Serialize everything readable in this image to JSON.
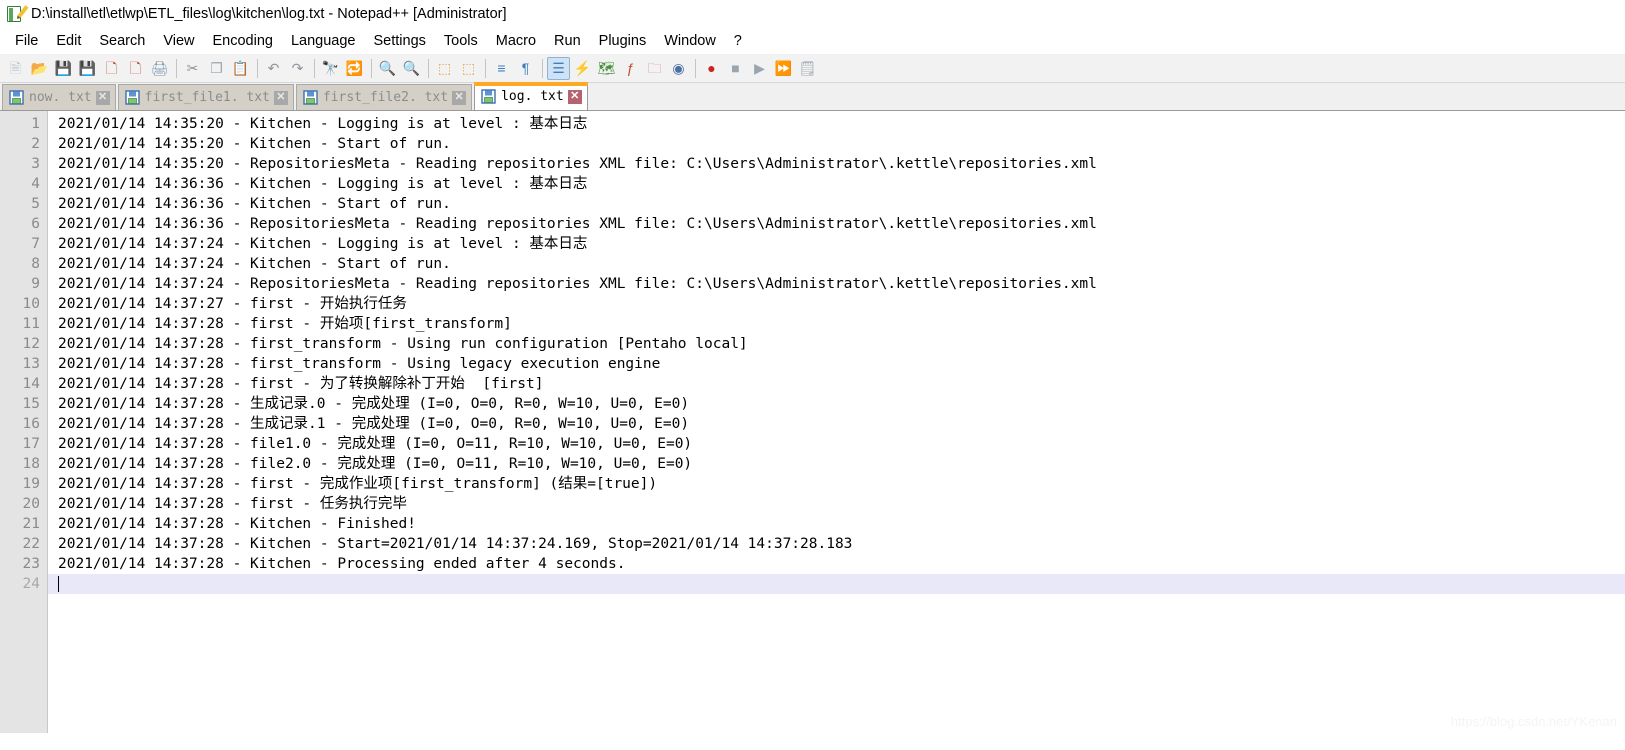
{
  "window": {
    "title": "D:\\install\\etl\\etlwp\\ETL_files\\log\\kitchen\\log.txt - Notepad++ [Administrator]",
    "app_icon": "notepad-plus-plus-icon"
  },
  "menu": {
    "items": [
      {
        "label": "File"
      },
      {
        "label": "Edit"
      },
      {
        "label": "Search"
      },
      {
        "label": "View"
      },
      {
        "label": "Encoding"
      },
      {
        "label": "Language"
      },
      {
        "label": "Settings"
      },
      {
        "label": "Tools"
      },
      {
        "label": "Macro"
      },
      {
        "label": "Run"
      },
      {
        "label": "Plugins"
      },
      {
        "label": "Window"
      },
      {
        "label": "?"
      }
    ]
  },
  "toolbar": {
    "buttons": [
      {
        "name": "new-file-icon",
        "glyph": "🗎",
        "color": "#b9c4cc",
        "active": false
      },
      {
        "name": "open-file-icon",
        "glyph": "📂",
        "color": "#e8a83c",
        "active": false
      },
      {
        "name": "save-icon",
        "glyph": "💾",
        "color": "#9aa5ad",
        "active": false
      },
      {
        "name": "save-all-icon",
        "glyph": "💾",
        "color": "#9aa5ad",
        "active": false
      },
      {
        "name": "close-file-icon",
        "glyph": "🗋",
        "color": "#c24a2e",
        "active": false
      },
      {
        "name": "close-all-files-icon",
        "glyph": "🗋",
        "color": "#c24a2e",
        "active": false
      },
      {
        "name": "print-icon",
        "glyph": "🖨",
        "color": "#7f97ad",
        "active": false
      },
      {
        "sep": true
      },
      {
        "name": "cut-icon",
        "glyph": "✂",
        "color": "#8d949b",
        "active": false
      },
      {
        "name": "copy-icon",
        "glyph": "❐",
        "color": "#9aa5ad",
        "active": false
      },
      {
        "name": "paste-icon",
        "glyph": "📋",
        "color": "#9aa5ad",
        "active": false
      },
      {
        "sep": true
      },
      {
        "name": "undo-icon",
        "glyph": "↶",
        "color": "#8d949b",
        "active": false
      },
      {
        "name": "redo-icon",
        "glyph": "↷",
        "color": "#8d949b",
        "active": false
      },
      {
        "sep": true
      },
      {
        "name": "find-icon",
        "glyph": "🔭",
        "color": "#4a545c",
        "active": false
      },
      {
        "name": "replace-icon",
        "glyph": "🔁",
        "color": "#3d7ec4",
        "active": false
      },
      {
        "sep": true
      },
      {
        "name": "zoom-in-icon",
        "glyph": "🔍",
        "color": "#4a8f3e",
        "active": false
      },
      {
        "name": "zoom-out-icon",
        "glyph": "🔍",
        "color": "#c24a2e",
        "active": false
      },
      {
        "sep": true
      },
      {
        "name": "sync-vertical-scroll-icon",
        "glyph": "⬚",
        "color": "#d8a73c",
        "active": false
      },
      {
        "name": "sync-horizontal-scroll-icon",
        "glyph": "⬚",
        "color": "#d8a73c",
        "active": false
      },
      {
        "sep": true
      },
      {
        "name": "word-wrap-icon",
        "glyph": "≡",
        "color": "#3d7ec4",
        "active": false
      },
      {
        "name": "show-all-characters-icon",
        "glyph": "¶",
        "color": "#3d7ec4",
        "active": false
      },
      {
        "sep": true
      },
      {
        "name": "indent-guideline-icon",
        "glyph": "☰",
        "color": "#3d7ec4",
        "active": true
      },
      {
        "name": "user-defined-language-icon",
        "glyph": "⚡",
        "color": "#e8c03c",
        "active": false
      },
      {
        "name": "document-map-icon",
        "glyph": "🗺",
        "color": "#4a8f3e",
        "active": false
      },
      {
        "name": "function-list-icon",
        "glyph": "ƒ",
        "color": "#c24a2e",
        "active": false
      },
      {
        "name": "folder-as-workspace-icon",
        "glyph": "🗀",
        "color": "#d98a8a",
        "active": false
      },
      {
        "name": "monitoring-icon",
        "glyph": "◉",
        "color": "#4a6fa5",
        "active": false
      },
      {
        "sep": true
      },
      {
        "name": "macro-record-icon",
        "glyph": "●",
        "color": "#cc2222",
        "active": false
      },
      {
        "name": "macro-stop-icon",
        "glyph": "■",
        "color": "#9aa5ad",
        "active": false
      },
      {
        "name": "macro-play-icon",
        "glyph": "▶",
        "color": "#9aa5ad",
        "active": false
      },
      {
        "name": "macro-run-multiple-icon",
        "glyph": "⏩",
        "color": "#3d7ec4",
        "active": false
      },
      {
        "name": "save-macro-icon",
        "glyph": "🗒",
        "color": "#9aa5ad",
        "active": false
      }
    ]
  },
  "tabs": [
    {
      "label": "now. txt",
      "active": false,
      "icon": "saved-file-icon"
    },
    {
      "label": "first_file1. txt",
      "active": false,
      "icon": "saved-file-icon"
    },
    {
      "label": "first_file2. txt",
      "active": false,
      "icon": "saved-file-icon"
    },
    {
      "label": "log. txt",
      "active": true,
      "icon": "saved-file-icon"
    }
  ],
  "editor": {
    "current_line": 24,
    "lines": [
      {
        "n": 1,
        "text": "2021/01/14 14:35:20 - Kitchen - Logging is at level : 基本日志"
      },
      {
        "n": 2,
        "text": "2021/01/14 14:35:20 - Kitchen - Start of run."
      },
      {
        "n": 3,
        "text": "2021/01/14 14:35:20 - RepositoriesMeta - Reading repositories XML file: C:\\Users\\Administrator\\.kettle\\repositories.xml"
      },
      {
        "n": 4,
        "text": "2021/01/14 14:36:36 - Kitchen - Logging is at level : 基本日志"
      },
      {
        "n": 5,
        "text": "2021/01/14 14:36:36 - Kitchen - Start of run."
      },
      {
        "n": 6,
        "text": "2021/01/14 14:36:36 - RepositoriesMeta - Reading repositories XML file: C:\\Users\\Administrator\\.kettle\\repositories.xml"
      },
      {
        "n": 7,
        "text": "2021/01/14 14:37:24 - Kitchen - Logging is at level : 基本日志"
      },
      {
        "n": 8,
        "text": "2021/01/14 14:37:24 - Kitchen - Start of run."
      },
      {
        "n": 9,
        "text": "2021/01/14 14:37:24 - RepositoriesMeta - Reading repositories XML file: C:\\Users\\Administrator\\.kettle\\repositories.xml"
      },
      {
        "n": 10,
        "text": "2021/01/14 14:37:27 - first - 开始执行任务"
      },
      {
        "n": 11,
        "text": "2021/01/14 14:37:28 - first - 开始项[first_transform]"
      },
      {
        "n": 12,
        "text": "2021/01/14 14:37:28 - first_transform - Using run configuration [Pentaho local]"
      },
      {
        "n": 13,
        "text": "2021/01/14 14:37:28 - first_transform - Using legacy execution engine"
      },
      {
        "n": 14,
        "text": "2021/01/14 14:37:28 - first - 为了转换解除补丁开始  [first]"
      },
      {
        "n": 15,
        "text": "2021/01/14 14:37:28 - 生成记录.0 - 完成处理 (I=0, O=0, R=0, W=10, U=0, E=0)"
      },
      {
        "n": 16,
        "text": "2021/01/14 14:37:28 - 生成记录.1 - 完成处理 (I=0, O=0, R=0, W=10, U=0, E=0)"
      },
      {
        "n": 17,
        "text": "2021/01/14 14:37:28 - file1.0 - 完成处理 (I=0, O=11, R=10, W=10, U=0, E=0)"
      },
      {
        "n": 18,
        "text": "2021/01/14 14:37:28 - file2.0 - 完成处理 (I=0, O=11, R=10, W=10, U=0, E=0)"
      },
      {
        "n": 19,
        "text": "2021/01/14 14:37:28 - first - 完成作业项[first_transform] (结果=[true])"
      },
      {
        "n": 20,
        "text": "2021/01/14 14:37:28 - first - 任务执行完毕"
      },
      {
        "n": 21,
        "text": "2021/01/14 14:37:28 - Kitchen - Finished!"
      },
      {
        "n": 22,
        "text": "2021/01/14 14:37:28 - Kitchen - Start=2021/01/14 14:37:24.169, Stop=2021/01/14 14:37:28.183"
      },
      {
        "n": 23,
        "text": "2021/01/14 14:37:28 - Kitchen - Processing ended after 4 seconds."
      },
      {
        "n": 24,
        "text": ""
      }
    ]
  },
  "watermark": {
    "text": "https://blog.csdn.net/YKenan"
  },
  "colors": {
    "active_tab_accent": "#ffa825",
    "current_line_highlight": "#e8e8f8",
    "gutter_bg": "#e4e4e4",
    "toolbar_bg": "#f2f2f2"
  }
}
